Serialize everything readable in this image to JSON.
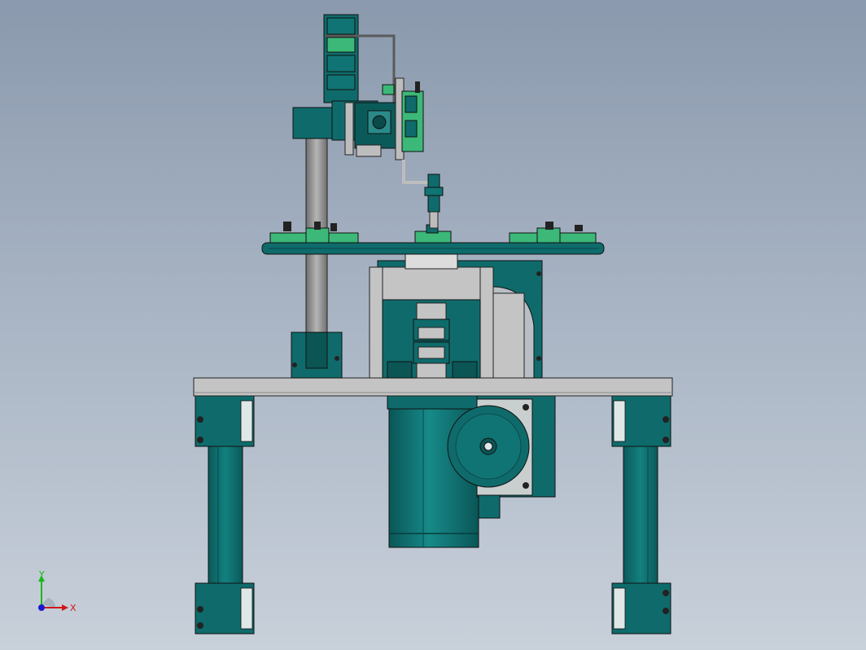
{
  "viewport": {
    "colors": {
      "background_top": "#8a99ad",
      "background_bottom": "#c8d0da",
      "frame_teal": "#0f6b6b",
      "part_green": "#3cb878",
      "metal_gray": "#a9a9a9",
      "plate_gray": "#c4c4c4"
    }
  },
  "triad": {
    "y_label": "Y",
    "x_label": "X",
    "colors": {
      "x": "#d01818",
      "y": "#18b818",
      "z": "#1818d0"
    }
  }
}
